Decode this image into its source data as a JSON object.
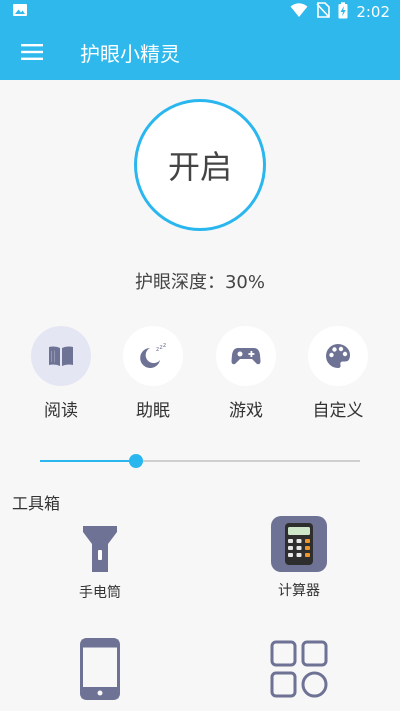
{
  "status": {
    "time": "2:02",
    "icons": [
      "image-icon",
      "wifi-icon",
      "no-sim-icon",
      "battery-charging-icon"
    ]
  },
  "appbar": {
    "title": "护眼小精灵",
    "menu_icon": "menu-icon"
  },
  "main": {
    "toggle_label": "开启",
    "depth_label": "护眼深度：",
    "depth_value": "30%",
    "modes": [
      {
        "label": "阅读",
        "icon": "book-icon",
        "active": true
      },
      {
        "label": "助眠",
        "icon": "moon-sleep-icon",
        "active": false
      },
      {
        "label": "游戏",
        "icon": "gamepad-icon",
        "active": false
      },
      {
        "label": "自定义",
        "icon": "palette-icon",
        "active": false
      }
    ],
    "slider_value": 0.3
  },
  "toolbox": {
    "title": "工具箱",
    "tools": [
      {
        "label": "手电筒",
        "icon": "flashlight-icon"
      },
      {
        "label": "计算器",
        "icon": "calculator-icon"
      },
      {
        "label": "",
        "icon": "phone-icon"
      },
      {
        "label": "",
        "icon": "apps-grid-icon"
      }
    ]
  },
  "colors": {
    "accent": "#2fb8ec",
    "icon_gray": "#6e7294",
    "background": "#f7f7f7"
  }
}
